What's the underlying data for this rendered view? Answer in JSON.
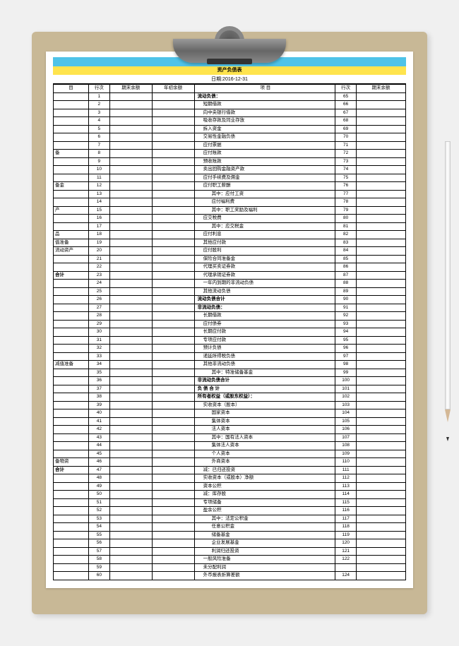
{
  "title": "资产负债表",
  "date_label": "日期:2016-12-31",
  "headers": {
    "c1": "目",
    "c2": "行次",
    "c3": "期末余额",
    "c4": "年初余额",
    "c5": "项           目",
    "c6": "行次",
    "c7": "期末余额"
  },
  "rows": [
    {
      "n1": "1",
      "label": "流动负债：",
      "n2": "65",
      "bold": true
    },
    {
      "n1": "2",
      "label": "短期借款",
      "n2": "66",
      "ind": 1
    },
    {
      "n1": "3",
      "label": "向中央银行借款",
      "n2": "67",
      "ind": 1
    },
    {
      "n1": "4",
      "label": "吸收存款及同业存放",
      "n2": "68",
      "ind": 1
    },
    {
      "n1": "5",
      "label": "拆入资金",
      "n2": "69",
      "ind": 1
    },
    {
      "n1": "6",
      "label": "交易性金融负债",
      "n2": "70",
      "ind": 1
    },
    {
      "n1": "7",
      "label": "应付票据",
      "n2": "71",
      "ind": 1
    },
    {
      "a": "备",
      "n1": "8",
      "label": "应付账款",
      "n2": "72",
      "ind": 1
    },
    {
      "n1": "9",
      "label": "预收账款",
      "n2": "73",
      "ind": 1
    },
    {
      "n1": "10",
      "label": "卖出回购金融资产款",
      "n2": "74",
      "ind": 1
    },
    {
      "n1": "11",
      "label": "应付手续费及佣金",
      "n2": "75",
      "ind": 1
    },
    {
      "a": "备金",
      "n1": "12",
      "label": "应付职工薪酬",
      "n2": "76",
      "ind": 1
    },
    {
      "n1": "13",
      "label": "其中：应付工资",
      "n2": "77",
      "ind": 2
    },
    {
      "n1": "14",
      "label": "应付福利费",
      "n2": "78",
      "ind": 2
    },
    {
      "a": "产",
      "n1": "15",
      "label": "其中：职工奖励及福利",
      "n2": "79",
      "ind": 2
    },
    {
      "n1": "16",
      "label": "应交税费",
      "n2": "80",
      "ind": 1
    },
    {
      "n1": "17",
      "label": "其中：应交税金",
      "n2": "81",
      "ind": 2
    },
    {
      "a": "品",
      "n1": "18",
      "label": "应付利息",
      "n2": "82",
      "ind": 1
    },
    {
      "a": "值准备",
      "n1": "19",
      "label": "其他应付款",
      "n2": "83",
      "ind": 1
    },
    {
      "a": "流动资产",
      "n1": "20",
      "label": "应付股利",
      "n2": "84",
      "ind": 1
    },
    {
      "n1": "21",
      "label": "保险合同准备金",
      "n2": "85",
      "ind": 1
    },
    {
      "n1": "22",
      "label": "代理买卖证券款",
      "n2": "86",
      "ind": 1
    },
    {
      "a": "合计",
      "n1": "23",
      "label": "代理承销证券款",
      "n2": "87",
      "ind": 1,
      "abold": true
    },
    {
      "n1": "24",
      "label": "一年内到期的非流动负债",
      "n2": "88",
      "ind": 1
    },
    {
      "n1": "25",
      "label": "其他流动负债",
      "n2": "89",
      "ind": 1
    },
    {
      "n1": "26",
      "label": "流动负债合计",
      "n2": "90",
      "bold": true
    },
    {
      "n1": "27",
      "label": "非流动负债：",
      "n2": "91",
      "bold": true
    },
    {
      "n1": "28",
      "label": "长期借款",
      "n2": "92",
      "ind": 1
    },
    {
      "n1": "29",
      "label": "应付债券",
      "n2": "93",
      "ind": 1
    },
    {
      "n1": "30",
      "label": "长期应付款",
      "n2": "94",
      "ind": 1
    },
    {
      "n1": "31",
      "label": "专项应付款",
      "n2": "95",
      "ind": 1
    },
    {
      "n1": "32",
      "label": "预计负债",
      "n2": "96",
      "ind": 1
    },
    {
      "n1": "33",
      "label": "递延所得税负债",
      "n2": "97",
      "ind": 1
    },
    {
      "a": "减值准备",
      "n1": "34",
      "label": "其他非流动负债",
      "n2": "98",
      "ind": 1
    },
    {
      "n1": "35",
      "label": "其中：特准储备基金",
      "n2": "99",
      "ind": 2
    },
    {
      "n1": "36",
      "label": "非流动负债合计",
      "n2": "100",
      "bold": true
    },
    {
      "n1": "37",
      "label": "负 债 合 计",
      "n2": "101",
      "bold": true
    },
    {
      "n1": "38",
      "label": "所有者权益（或股东权益）：",
      "n2": "102",
      "bold": true
    },
    {
      "n1": "39",
      "label": "实收资本（股本）",
      "n2": "103",
      "ind": 1
    },
    {
      "n1": "40",
      "label": "国家资本",
      "n2": "104",
      "ind": 2
    },
    {
      "n1": "41",
      "label": "集体资本",
      "n2": "105",
      "ind": 2
    },
    {
      "n1": "42",
      "label": "法人资本",
      "n2": "106",
      "ind": 2
    },
    {
      "n1": "43",
      "label": "其中：国有法人资本",
      "n2": "107",
      "ind": 2
    },
    {
      "n1": "44",
      "label": "集体法人资本",
      "n2": "108",
      "ind": 2
    },
    {
      "n1": "45",
      "label": "个人资本",
      "n2": "109",
      "ind": 2
    },
    {
      "a": "备物资",
      "n1": "46",
      "label": "外商资本",
      "n2": "110",
      "ind": 2
    },
    {
      "a": "合计",
      "n1": "47",
      "label": "减：已归还投资",
      "n2": "111",
      "ind": 1,
      "abold": true
    },
    {
      "n1": "48",
      "label": "实收资本（或股本）净额",
      "n2": "112",
      "ind": 1
    },
    {
      "n1": "49",
      "label": "资本公积",
      "n2": "113",
      "ind": 1
    },
    {
      "n1": "50",
      "label": "减：库存股",
      "n2": "114",
      "ind": 1
    },
    {
      "n1": "51",
      "label": "专项储备",
      "n2": "115",
      "ind": 1
    },
    {
      "n1": "52",
      "label": "盈余公积",
      "n2": "116",
      "ind": 1
    },
    {
      "n1": "53",
      "label": "其中：法定公积金",
      "n2": "117",
      "ind": 2
    },
    {
      "n1": "54",
      "label": "任意公积金",
      "n2": "118",
      "ind": 2
    },
    {
      "n1": "55",
      "label": "储备基金",
      "n2": "119",
      "ind": 2
    },
    {
      "n1": "56",
      "label": "企业发展基金",
      "n2": "120",
      "ind": 2
    },
    {
      "n1": "57",
      "label": "利润归还投资",
      "n2": "121",
      "ind": 2
    },
    {
      "n1": "58",
      "label": "一般风险准备",
      "n2": "122",
      "ind": 1
    },
    {
      "n1": "59",
      "label": "未分配利润",
      "n2": "",
      "ind": 1
    },
    {
      "n1": "60",
      "label": "外币报表折算差额",
      "n2": "124",
      "ind": 1
    }
  ]
}
